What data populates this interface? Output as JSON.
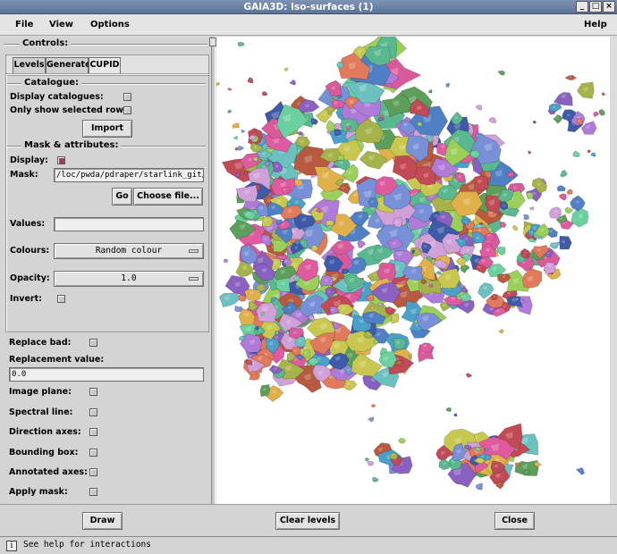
{
  "window": {
    "title": "GAIA3D: Iso-surfaces (1)"
  },
  "menu": {
    "file": "File",
    "view": "View",
    "options": "Options",
    "help": "Help"
  },
  "controls": {
    "title": "Controls:",
    "tabs": [
      "Levels",
      "Generate",
      "CUPID"
    ],
    "active_tab": "CUPID"
  },
  "catalogue": {
    "title": "Catalogue:",
    "display_catalogues": "Display catalogues:",
    "only_selected_rows": "Only show selected rows:",
    "import": "Import"
  },
  "mask": {
    "title": "Mask & attributes:",
    "display": "Display:",
    "mask_label": "Mask:",
    "mask_value": "/loc/pwda/pdraper/starlink_git/",
    "go": "Go",
    "choose_file": "Choose file...",
    "values_label": "Values:",
    "values_value": "",
    "colours_label": "Colours:",
    "colours_value": "Random colour",
    "opacity_label": "Opacity:",
    "opacity_value": "1.0",
    "invert": "Invert:"
  },
  "options": {
    "replace_bad": "Replace bad:",
    "replacement_value_label": "Replacement value:",
    "replacement_value": "0.0",
    "image_plane": "Image plane:",
    "spectral_line": "Spectral line:",
    "direction_axes": "Direction axes:",
    "bounding_box": "Bounding box:",
    "annotated_axes": "Annotated axes:",
    "apply_mask": "Apply mask:"
  },
  "buttons": {
    "draw": "Draw",
    "clear_levels": "Clear levels",
    "close": "Close"
  },
  "status": {
    "icon": "i",
    "text": "See help for interactions"
  },
  "colors": {
    "title_bar": "#6b82a8",
    "checked": "#a0405c"
  }
}
